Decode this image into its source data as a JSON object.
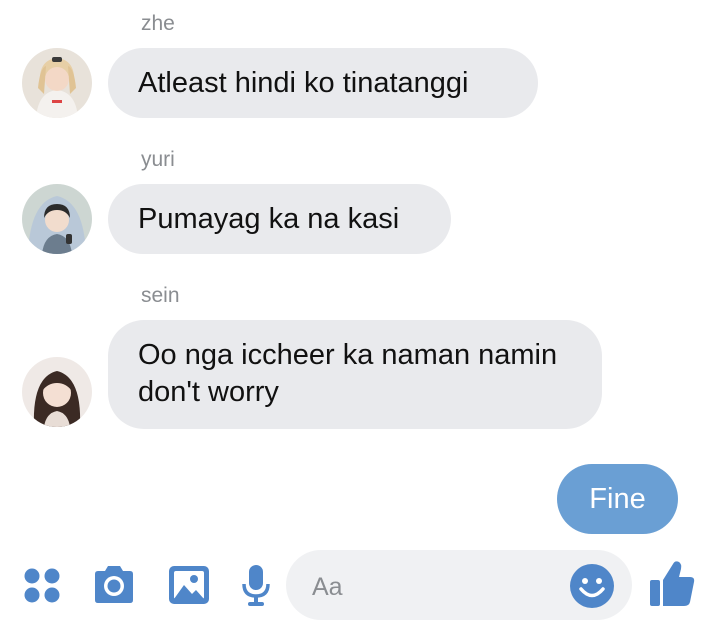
{
  "conversation": {
    "messages": [
      {
        "sender": "zhe",
        "text": "Atleast hindi ko tinatanggi"
      },
      {
        "sender": "yuri",
        "text": "Pumayag ka na kasi"
      },
      {
        "sender": "sein",
        "text": "Oo nga iccheer ka naman namin don't worry"
      }
    ],
    "outgoing": {
      "text": "Fine"
    }
  },
  "composer": {
    "placeholder": "Aa",
    "icons": [
      "apps-grid-icon",
      "camera-icon",
      "gallery-icon",
      "microphone-icon",
      "emoji-icon",
      "thumbs-up-icon"
    ]
  },
  "colors": {
    "incoming_bubble": "#e9eaed",
    "outgoing_bubble": "#6a9fd4",
    "accent_icon": "#4f86c9",
    "sender_name": "#8a8d91"
  }
}
